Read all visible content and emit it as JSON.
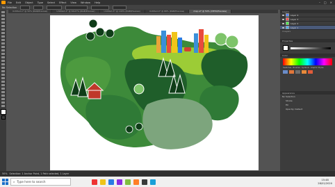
{
  "menubar": {
    "items": [
      "File",
      "Edit",
      "Object",
      "Type",
      "Select",
      "Effect",
      "View",
      "Window",
      "Help"
    ]
  },
  "window_controls": [
    "–",
    "□",
    "×"
  ],
  "controlbar": {
    "selection_label": "No Selection"
  },
  "doc_tabs": [
    {
      "label": "Untitled-1* @ 50% (RGB/Preview)",
      "active": false
    },
    {
      "label": "Untitled-2* @ 66.67% (RGB/Preview)",
      "active": false
    },
    {
      "label": "Untitled-3* @ 100% (RGB/Preview)",
      "active": false
    },
    {
      "label": "Untitled-4* @ 66% (RGB/Preview)",
      "active": false
    },
    {
      "label": "map.ai* @ 50% (CMYK/Preview)",
      "active": true
    }
  ],
  "layers_panel": {
    "tab": "Layers",
    "rows": [
      {
        "name": "Layer 4",
        "color": "#4f7fff",
        "selected": false
      },
      {
        "name": "Layer 3",
        "color": "#ff4f4f",
        "selected": false
      },
      {
        "name": "Layer 2",
        "color": "#4fff4f",
        "selected": false
      },
      {
        "name": "Layer 1",
        "color": "#4fafff",
        "selected": true
      }
    ],
    "count": "4 Layers"
  },
  "properties_panel": {
    "tab": "Properties"
  },
  "color_panel": {
    "tab": "Color",
    "tabs2": [
      "Swatches",
      "Brushes",
      "Symbols",
      "Graphic Styles"
    ]
  },
  "appearance_panel": {
    "tab": "Appearance",
    "selection": "No Selection",
    "rows": [
      "Stroke",
      "Fill",
      "Opacity: Default"
    ]
  },
  "statusbar": {
    "zoom": "50%",
    "status": "Selection: 1 Anchor Point, 1 Path selected, 1 Layer"
  },
  "taskbar": {
    "search_placeholder": "Type here to search",
    "app_colors": [
      "#e33",
      "#f0c419",
      "#2a7be4",
      "#8a2be2",
      "#7fbf3f",
      "#ff7f27",
      "#3a3a3a",
      "#19a0d8"
    ],
    "time": "15:48",
    "date": "28/01/2020"
  },
  "palette": {
    "dark_green": "#1f5e2a",
    "mid_green": "#2f7a36",
    "light_green": "#3d8a3a",
    "pale_green": "#7da57d",
    "lime": "#9ccc36",
    "house_red": "#c0392b"
  }
}
